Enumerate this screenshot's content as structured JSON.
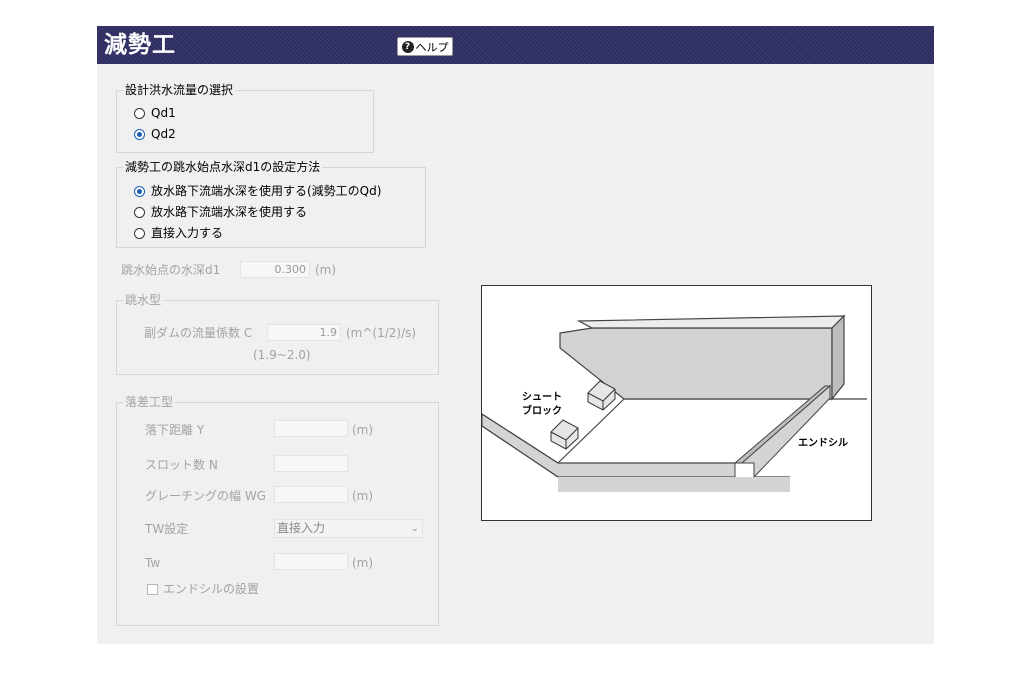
{
  "window": {
    "title": "減勢工",
    "help_label": "ヘルプ",
    "help_icon": "question-circle-icon"
  },
  "flow_selection": {
    "legend": "設計洪水流量の選択",
    "options": [
      {
        "label": "Qd1",
        "selected": false
      },
      {
        "label": "Qd2",
        "selected": true
      }
    ]
  },
  "depth_method": {
    "legend": "減勢工の跳水始点水深d1の設定方法",
    "options": [
      {
        "label": "放水路下流端水深を使用する(減勢工のQd)",
        "selected": true
      },
      {
        "label": "放水路下流端水深を使用する",
        "selected": false
      },
      {
        "label": "直接入力する",
        "selected": false
      }
    ]
  },
  "depth_d1": {
    "label": "跳水始点の水深d1",
    "value": "0.300",
    "unit": "(m)"
  },
  "jump_type": {
    "legend": "跳水型",
    "coef_label": "副ダムの流量係数 C",
    "coef_value": "1.9",
    "coef_unit": "(m^(1/2)/s)",
    "coef_range": "(1.9~2.0)"
  },
  "drop_type": {
    "legend": "落差工型",
    "fall_label": "落下距離 Y",
    "fall_value": "",
    "fall_unit": "(m)",
    "slot_label": "スロット数 N",
    "slot_value": "",
    "grating_label": "グレーチングの幅 WG",
    "grating_value": "",
    "grating_unit": "(m)",
    "tw_setting_label": "TW設定",
    "tw_setting_value": "直接入力",
    "tw_label": "Tw",
    "tw_value": "",
    "tw_unit": "(m)",
    "endsill_label": "エンドシルの設置",
    "endsill_checked": false
  },
  "diagram": {
    "chute_block_label_1": "シュート",
    "chute_block_label_2": "ブロック",
    "endsill_label": "エンドシル"
  },
  "colors": {
    "title_bg": "#2d2d62",
    "radio_on": "#1a5fb4",
    "disabled_text": "#a3a3a3"
  }
}
